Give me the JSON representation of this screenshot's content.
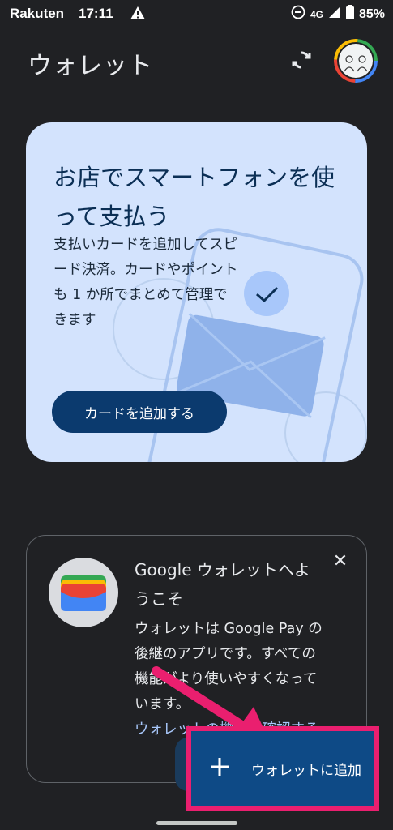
{
  "status_bar": {
    "carrier": "Rakuten",
    "time": "17:11",
    "network": "4G",
    "battery": "85%",
    "icons": [
      "warning-icon",
      "do-not-disturb-icon",
      "signal-icon",
      "battery-icon"
    ]
  },
  "app_bar": {
    "title": "ウォレット",
    "sync_icon": "sync-icon",
    "avatar": "account-avatar"
  },
  "promo_card": {
    "title": "お店でスマートフォンを使って支払う",
    "description": "支払いカードを追加してスピード決済。カードやポイントも 1 か所でまとめて管理できます",
    "button_label": "カードを追加する"
  },
  "welcome_card": {
    "logo_icon": "google-wallet-icon",
    "close_icon": "close-icon",
    "title": "Google ウォレットへようこそ",
    "body": "ウォレットは Google Pay の後継のアプリです。すべての機能がより使いやすくなっています。",
    "link_text": "ウォレットの機能を確認する"
  },
  "fab": {
    "icon": "plus-icon",
    "label": "ウォレットに追加"
  },
  "colors": {
    "background": "#202124",
    "promo_card": "#d3e3fd",
    "primary_button": "#0b3a6e",
    "fab": "#0e4a86",
    "highlight": "#ea1f6f",
    "link": "#a8c7fa"
  }
}
